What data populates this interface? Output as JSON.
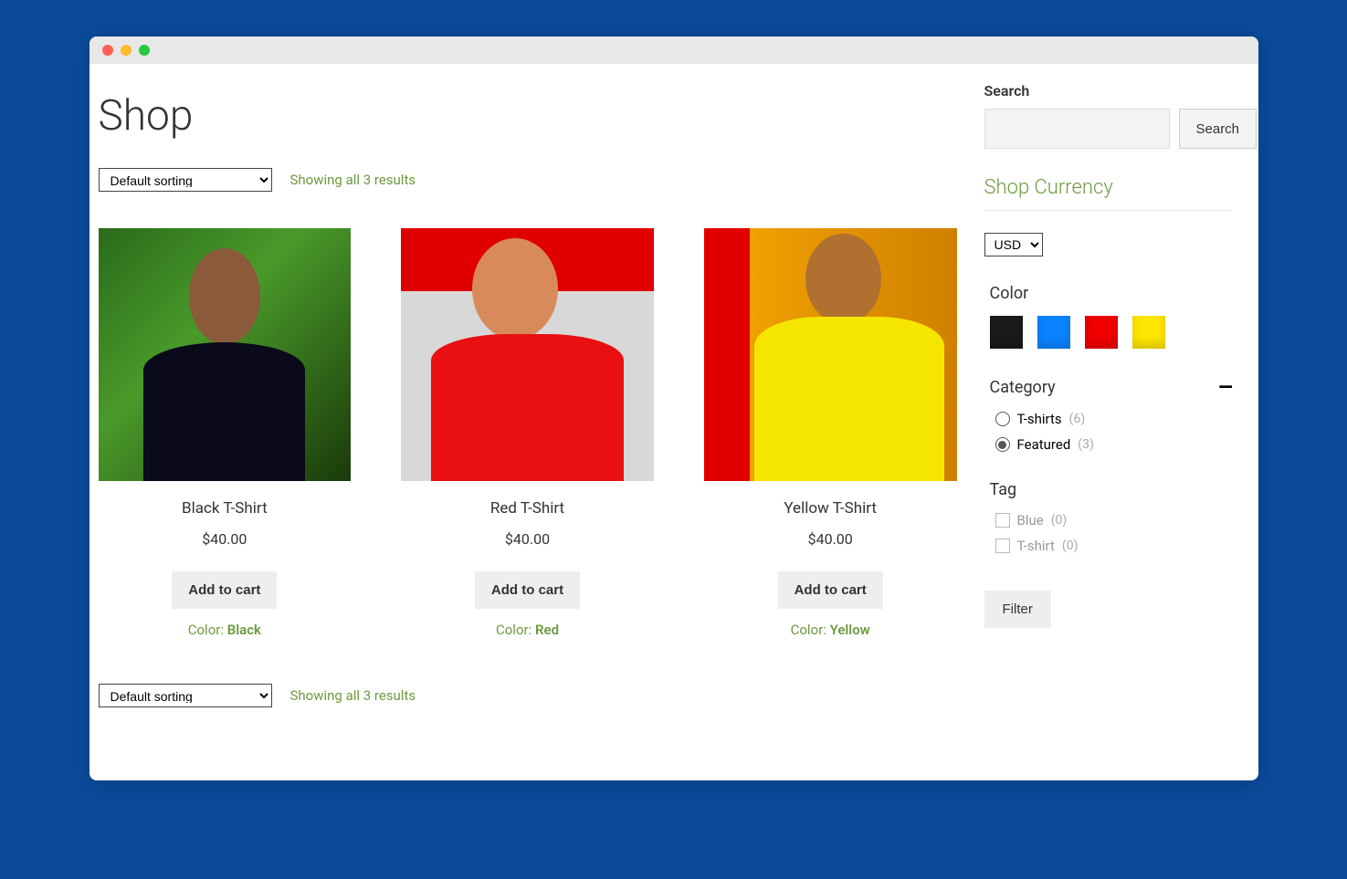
{
  "page_title": "Shop",
  "sort_option": "Default sorting",
  "result_count": "Showing all 3 results",
  "products": [
    {
      "title": "Black T-Shirt",
      "price": "$40.00",
      "cart": "Add to cart",
      "color_label": "Color:",
      "color": "Black"
    },
    {
      "title": "Red T-Shirt",
      "price": "$40.00",
      "cart": "Add to cart",
      "color_label": "Color:",
      "color": "Red"
    },
    {
      "title": "Yellow T-Shirt",
      "price": "$40.00",
      "cart": "Add to cart",
      "color_label": "Color:",
      "color": "Yellow"
    }
  ],
  "sidebar": {
    "search_label": "Search",
    "search_button": "Search",
    "currency_title": "Shop Currency",
    "currency_value": "USD",
    "color_title": "Color",
    "swatches": [
      {
        "name": "black",
        "hex": "#1a1a1a"
      },
      {
        "name": "blue",
        "hex": "#0a84ff"
      },
      {
        "name": "red",
        "hex": "#f00000"
      },
      {
        "name": "yellow",
        "hex": "#ffe600"
      }
    ],
    "category_title": "Category",
    "categories": [
      {
        "label": "T-shirts",
        "count": "(6)",
        "checked": false
      },
      {
        "label": "Featured",
        "count": "(3)",
        "checked": true
      }
    ],
    "tag_title": "Tag",
    "tags": [
      {
        "label": "Blue",
        "count": "(0)"
      },
      {
        "label": "T-shirt",
        "count": "(0)"
      }
    ],
    "filter_button": "Filter"
  }
}
